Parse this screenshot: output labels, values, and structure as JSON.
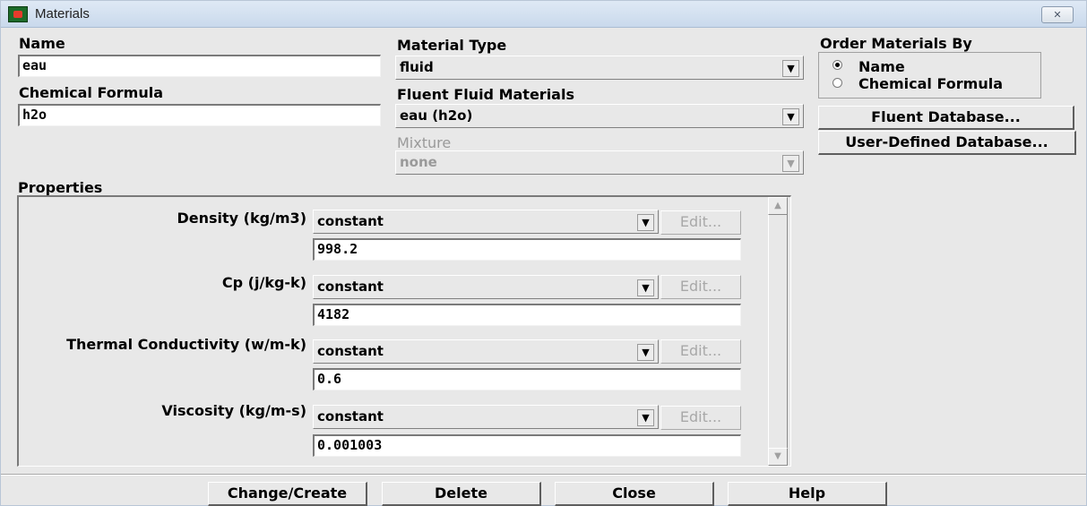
{
  "window": {
    "title": "Materials",
    "close_glyph": "✕"
  },
  "name": {
    "label": "Name",
    "value": "eau"
  },
  "chemical_formula": {
    "label": "Chemical Formula",
    "value": "h2o"
  },
  "material_type": {
    "label": "Material Type",
    "value": "fluid"
  },
  "fluent_fluid_materials": {
    "label": "Fluent Fluid Materials",
    "value": "eau (h2o)"
  },
  "mixture": {
    "label": "Mixture",
    "value": "none",
    "disabled": true
  },
  "order_by": {
    "label": "Order Materials By",
    "options": [
      {
        "label": "Name",
        "checked": true
      },
      {
        "label": "Chemical Formula",
        "checked": false
      }
    ]
  },
  "database_buttons": {
    "fluent": "Fluent Database...",
    "user_defined": "User-Defined Database..."
  },
  "properties": {
    "label": "Properties",
    "items": [
      {
        "label": "Density (kg/m3)",
        "method": "constant",
        "value": "998.2",
        "edit": "Edit..."
      },
      {
        "label": "Cp (j/kg-k)",
        "method": "constant",
        "value": "4182",
        "edit": "Edit..."
      },
      {
        "label": "Thermal Conductivity (w/m-k)",
        "method": "constant",
        "value": "0.6",
        "edit": "Edit..."
      },
      {
        "label": "Viscosity (kg/m-s)",
        "method": "constant",
        "value": "0.001003",
        "edit": "Edit..."
      }
    ]
  },
  "actions": {
    "change_create": "Change/Create",
    "delete": "Delete",
    "close": "Close",
    "help": "Help"
  },
  "icons": {
    "dropdown_arrow": "▼",
    "scroll_up": "▲",
    "scroll_down": "▼"
  }
}
